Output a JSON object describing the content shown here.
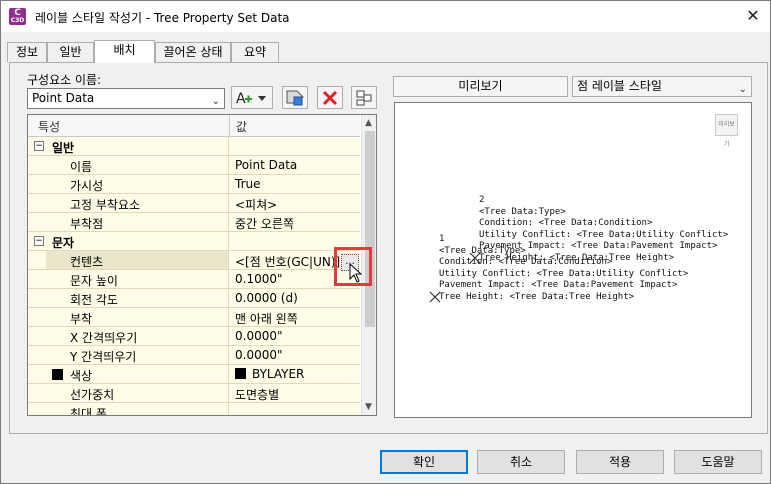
{
  "window": {
    "title": "레이블 스타일 작성기 - Tree Property Set Data",
    "app_icon_letter": "C",
    "app_icon_sub": "C3D",
    "close_glyph": "✕"
  },
  "tabs": [
    {
      "label": "정보",
      "active": false
    },
    {
      "label": "일반",
      "active": false
    },
    {
      "label": "배치",
      "active": true
    },
    {
      "label": "끌어온 상태",
      "active": false
    },
    {
      "label": "요약",
      "active": false
    }
  ],
  "component": {
    "label": "구성요소 이름:",
    "selected": "Point Data"
  },
  "toolbar": {
    "add_icon": "add-component-icon",
    "copy_icon": "copy-component-icon",
    "delete_icon": "delete-component-icon",
    "order_icon": "component-draw-order-icon",
    "accent_delete": "#e02020"
  },
  "grid": {
    "header_property": "특성",
    "header_value": "값",
    "rows": [
      {
        "kind": "cat",
        "label": "일반",
        "value": "",
        "expander": "−"
      },
      {
        "kind": "prop",
        "label": "이름",
        "value": "Point Data"
      },
      {
        "kind": "prop",
        "label": "가시성",
        "value": "True"
      },
      {
        "kind": "prop",
        "label": "고정 부착요소",
        "value": "<피쳐>"
      },
      {
        "kind": "prop",
        "label": "부착점",
        "value": "중간 오른쪽"
      },
      {
        "kind": "cat",
        "label": "문자",
        "value": "",
        "expander": "−"
      },
      {
        "kind": "prop",
        "label": "컨텐츠",
        "value": "<[점 번호(GC|UN)]>",
        "selected": true
      },
      {
        "kind": "prop",
        "label": "문자 높이",
        "value": "0.1000\""
      },
      {
        "kind": "prop",
        "label": "회전 각도",
        "value": "0.0000 (d)"
      },
      {
        "kind": "prop",
        "label": "부착",
        "value": "맨 아래 왼쪽"
      },
      {
        "kind": "prop",
        "label": "X 간격띄우기",
        "value": "0.0000\""
      },
      {
        "kind": "prop",
        "label": "Y 간격띄우기",
        "value": "0.0000\""
      },
      {
        "kind": "prop-swatch",
        "label": "색상",
        "value": "BYLAYER"
      },
      {
        "kind": "prop",
        "label": "선가중치",
        "value": "도면층별"
      },
      {
        "kind": "prop",
        "label": "최대 폭",
        "value": ""
      }
    ],
    "ellipsis": "..."
  },
  "preview": {
    "label": "미리보기",
    "style_selected": "점 레이블 스타일",
    "icon_text": "미리보기",
    "lines_block2": [
      "2",
      "<Tree Data:Type>",
      "Condition: <Tree Data:Condition>",
      "Utility Conflict: <Tree Data:Utility Conflict>",
      "Pavement Impact: <Tree Data:Pavement Impact>",
      "Tree Height: <Tree Data:Tree Height>"
    ],
    "lines_block1": [
      "1",
      "<Tree Data:Type>",
      "Condition: <Tree Data:Condition>",
      "Utility Conflict: <Tree Data:Utility Conflict>",
      "Pavement Impact: <Tree Data:Pavement Impact>",
      "Tree Height: <Tree Data:Tree Height>"
    ]
  },
  "buttons": {
    "ok": "확인",
    "cancel": "취소",
    "apply": "적용",
    "help": "도움말"
  }
}
